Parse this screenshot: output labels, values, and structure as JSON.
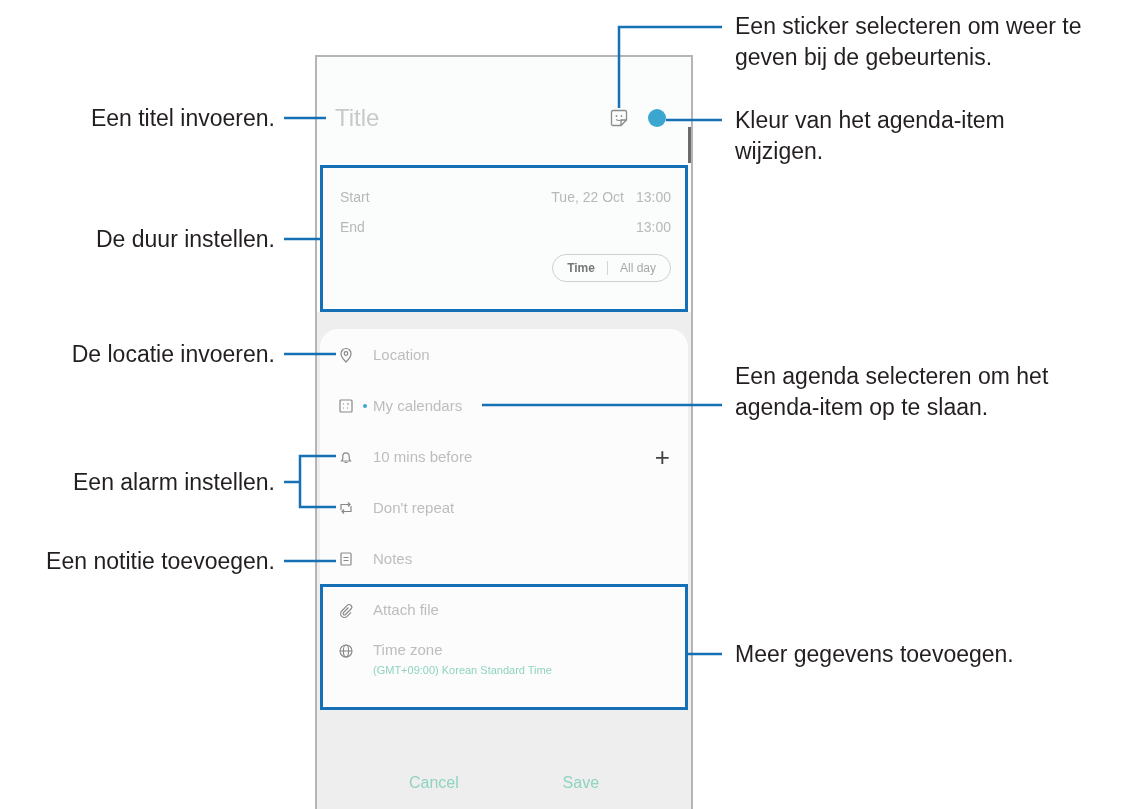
{
  "phone": {
    "title": {
      "placeholder": "Title"
    },
    "color": "#3ba7d0",
    "date": [
      {
        "label": "Start",
        "date": "Tue, 22 Oct",
        "time": "13:00"
      },
      {
        "label": "End",
        "time": "13:00"
      }
    ],
    "toggle": [
      {
        "label": "Time",
        "selected": true
      },
      {
        "label": "All day",
        "selected": false
      }
    ],
    "fields": [
      {
        "kind": "location",
        "text": "Location"
      },
      {
        "kind": "calendar",
        "text": "My calendars",
        "color": "#3ba7d0"
      },
      {
        "kind": "alarm",
        "text": "10 mins before",
        "action": "+"
      },
      {
        "kind": "repeat",
        "text": "Don't repeat"
      },
      {
        "kind": "notes",
        "text": "Notes"
      }
    ],
    "more": [
      {
        "kind": "attach",
        "text": "Attach file"
      },
      {
        "kind": "timezone",
        "text": "Time zone",
        "detail": "(GMT+09:00) Korean Standard Time"
      }
    ],
    "buttons": [
      "Cancel",
      "Save"
    ]
  },
  "callouts": [
    {
      "lines": [
        "Een sticker selecteren om weer te",
        "geven bij de gebeurtenis."
      ]
    },
    {
      "lines": [
        "Een titel invoeren."
      ]
    },
    {
      "lines": [
        "Kleur van het agenda-item",
        "wijzigen."
      ]
    },
    {
      "lines": [
        "De duur instellen."
      ]
    },
    {
      "lines": [
        "De locatie invoeren."
      ]
    },
    {
      "lines": [
        "Een agenda selecteren om het",
        "agenda-item op te slaan."
      ]
    },
    {
      "lines": [
        "Een alarm instellen."
      ]
    },
    {
      "lines": [
        "Een notitie toevoegen."
      ]
    },
    {
      "lines": [
        "Meer gegevens toevoegen."
      ]
    }
  ]
}
